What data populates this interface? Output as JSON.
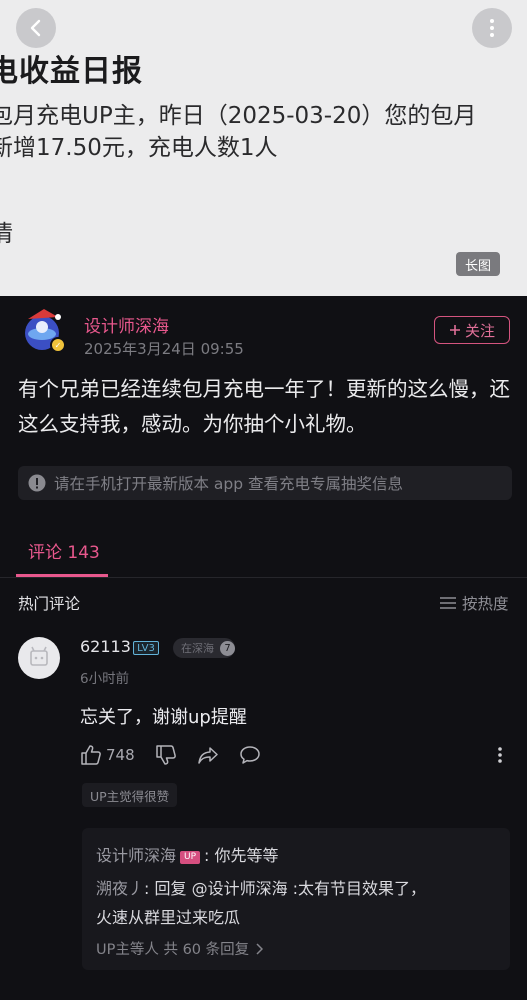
{
  "notification": {
    "title": "电收益日报",
    "line1": "包月充电UP主，昨日（2025-03-20）您的包月",
    "line2": "新增17.50元，充电人数1人",
    "more": "情",
    "long_image_tag": "长图"
  },
  "post": {
    "author": "设计师深海",
    "time": "2025年3月24日 09:55",
    "follow_label": "关注",
    "body": "有个兄弟已经连续包月充电一年了！更新的这么慢，还这么支持我，感动。为你抽个小礼物。",
    "notice": "请在手机打开最新版本 app 查看充电专属抽奖信息"
  },
  "comments_tab": {
    "label": "评论 143",
    "hot_label": "热门评论",
    "sort_label": "按热度"
  },
  "comment": {
    "user": "62113",
    "level_badge": "LV3",
    "fan_badge": "在深海",
    "fan_level": "7",
    "time": "6小时前",
    "text": "忘关了，谢谢up提醒",
    "likes": "748",
    "up_liked": "UP主觉得很赞",
    "replies": [
      {
        "name": "设计师深海",
        "tag": "UP",
        "text": ": 你先等等"
      },
      {
        "name": "溯夜丿",
        "text_part1": ": 回复 @设计师深海 :太有节目效果了，",
        "text_part2": "火速从群里过来吃瓜"
      }
    ],
    "reply_summary": "UP主等人  共 60 条回复"
  },
  "colors": {
    "accent": "#e8588d",
    "background": "#101014",
    "top_card": "#ececed"
  }
}
